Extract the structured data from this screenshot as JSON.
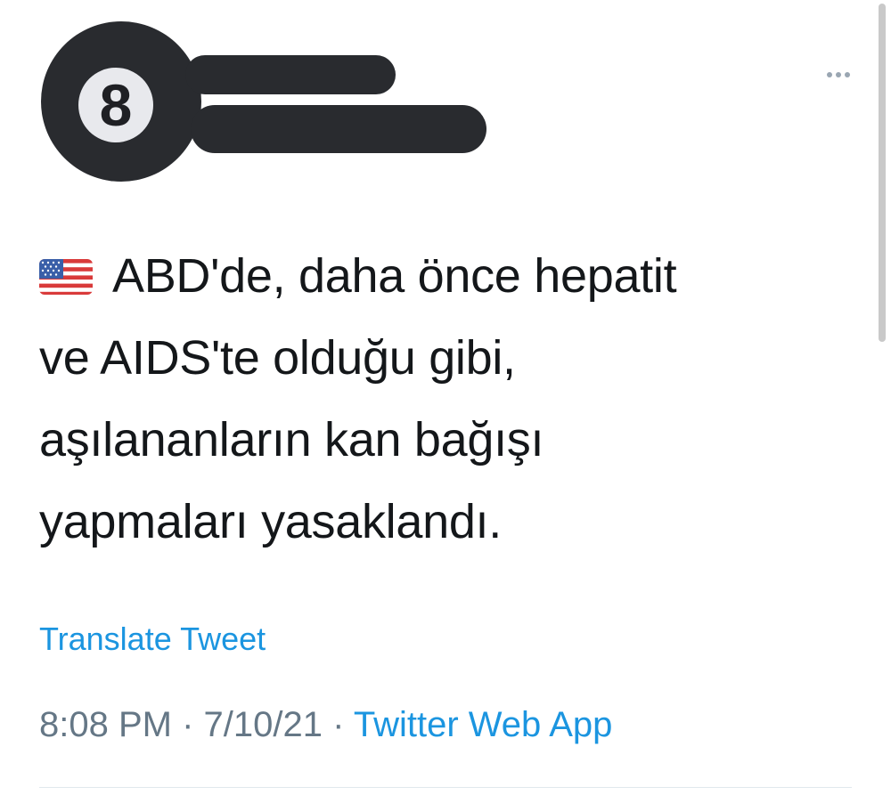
{
  "avatar": {
    "label": "8",
    "icon": "eight-ball-icon"
  },
  "header": {
    "more_icon": "more-horizontal-icon"
  },
  "tweet": {
    "flag_icon": "us-flag-icon",
    "lines": [
      "ABD'de, daha önce hepatit",
      "ve AIDS'te olduğu gibi,",
      "aşılananların kan bağışı",
      "yapmaları yasaklandı."
    ],
    "translate_label": "Translate Tweet"
  },
  "meta": {
    "time": "8:08 PM",
    "separator": "·",
    "date": "7/10/21",
    "source": "Twitter Web App"
  },
  "colors": {
    "link": "#1b95e0",
    "meta": "#657786",
    "text": "#14171a",
    "redaction": "#292b2f"
  }
}
